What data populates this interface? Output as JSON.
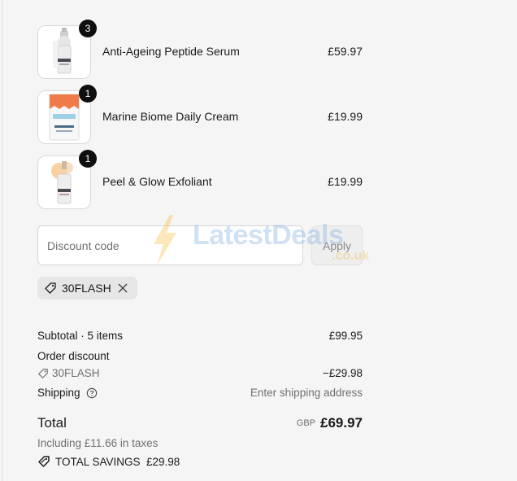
{
  "items": [
    {
      "name": "Anti-Ageing Peptide Serum",
      "price": "£59.97",
      "qty": "3",
      "image": "serum-bottle"
    },
    {
      "name": "Marine Biome Daily Cream",
      "price": "£19.99",
      "qty": "1",
      "image": "cream-box"
    },
    {
      "name": "Peel & Glow Exfoliant",
      "price": "£19.99",
      "qty": "1",
      "image": "exfoliant-bottle"
    }
  ],
  "discount": {
    "placeholder": "Discount code",
    "apply_label": "Apply",
    "applied_code": "30FLASH"
  },
  "watermark": {
    "text": "LatestDeals",
    "sub": ".co.uk"
  },
  "summary": {
    "subtotal_label": "Subtotal · 5 items",
    "subtotal_value": "£99.95",
    "order_discount_label": "Order discount",
    "discount_code": "30FLASH",
    "discount_value": "−£29.98",
    "shipping_label": "Shipping",
    "shipping_value": "Enter shipping address",
    "total_label": "Total",
    "currency": "GBP",
    "total_value": "£69.97",
    "taxes": "Including £11.66 in taxes",
    "savings": "TOTAL SAVINGS  £29.98"
  },
  "colors": {
    "accent": "#0f0f0f",
    "muted": "#707070",
    "background": "#f5f5f5"
  }
}
